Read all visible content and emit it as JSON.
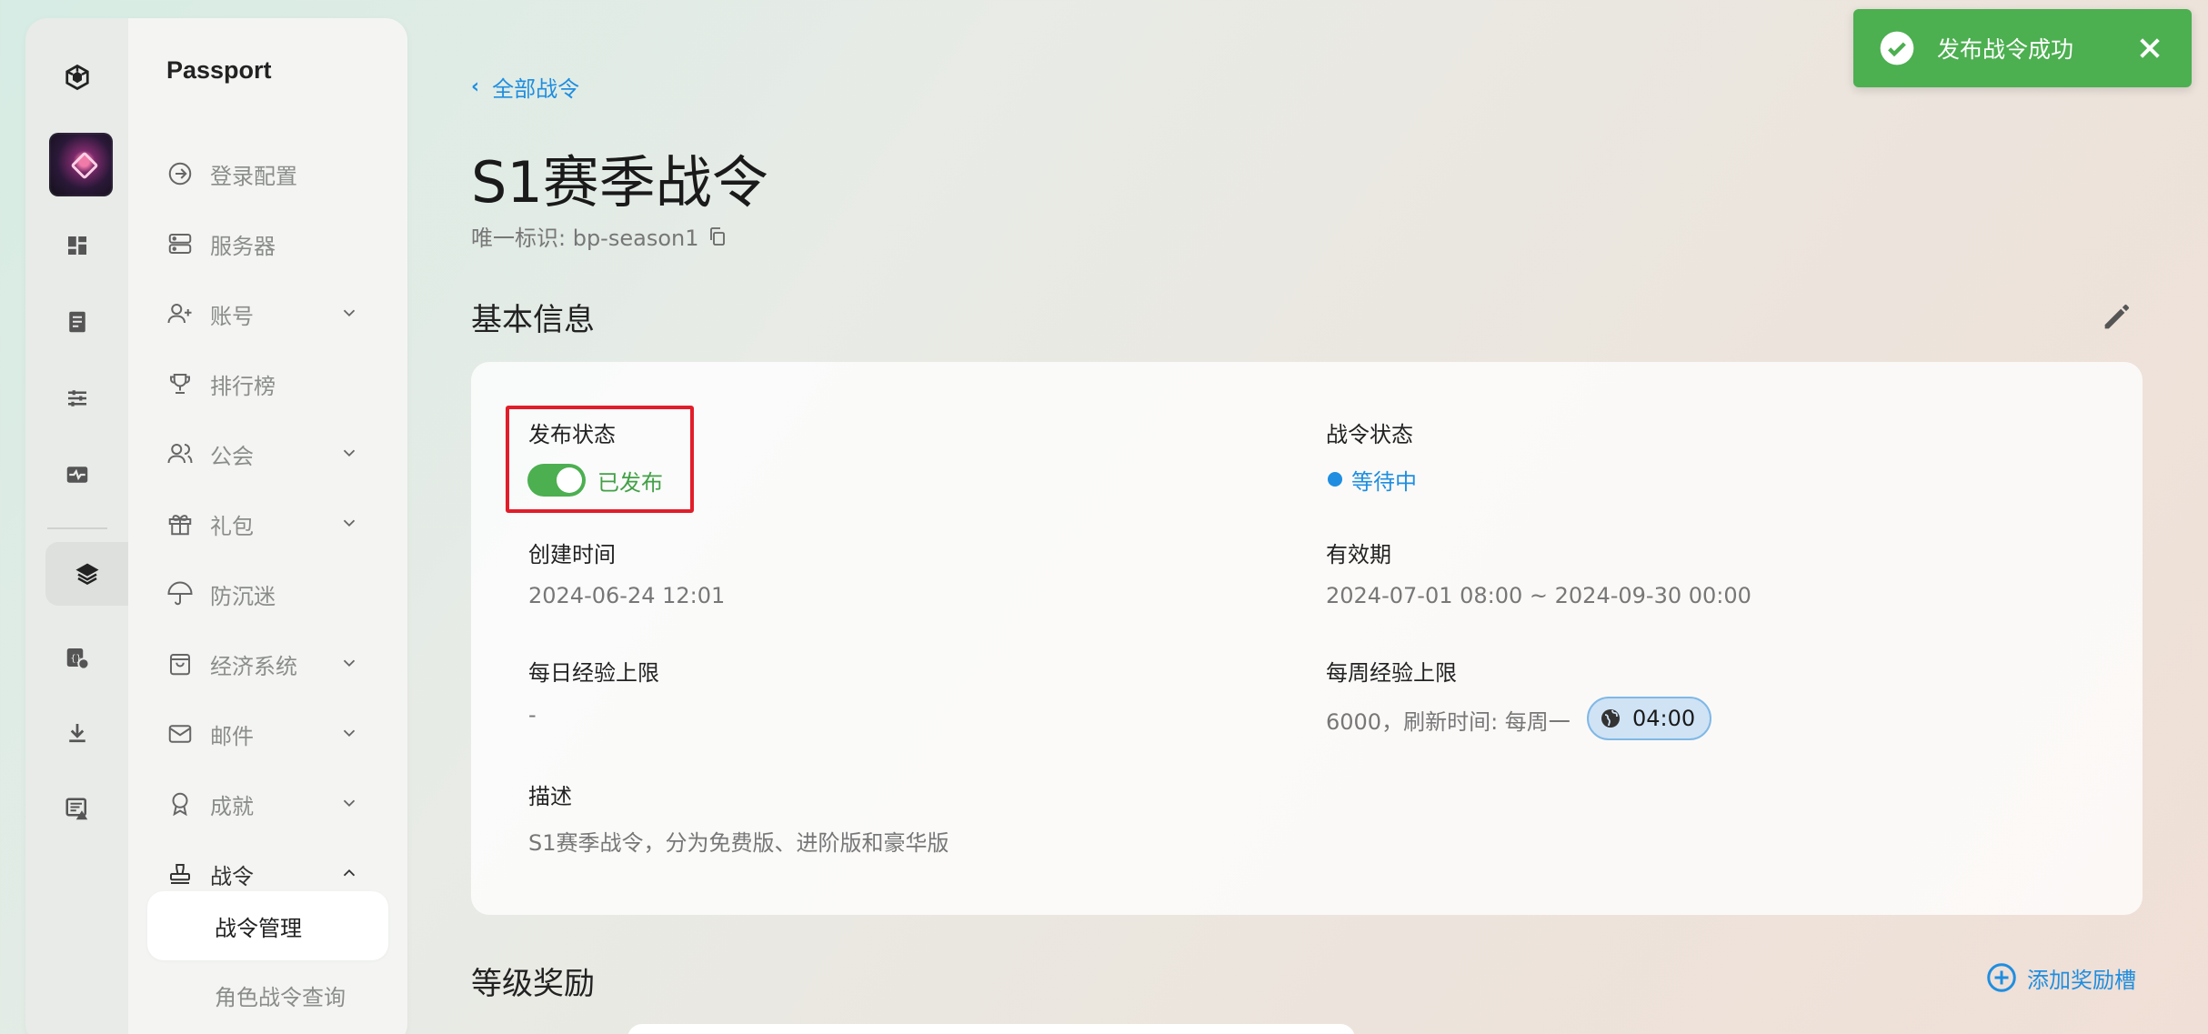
{
  "brand": "Passport",
  "menu": {
    "items": [
      {
        "label": "登录配置",
        "icon": "arrow-right-circle-icon"
      },
      {
        "label": "服务器",
        "icon": "server-icon"
      },
      {
        "label": "账号",
        "icon": "user-plus-icon"
      },
      {
        "label": "排行榜",
        "icon": "trophy-icon"
      },
      {
        "label": "公会",
        "icon": "users-icon"
      },
      {
        "label": "礼包",
        "icon": "gift-icon"
      },
      {
        "label": "防沉迷",
        "icon": "umbrella-icon"
      },
      {
        "label": "经济系统",
        "icon": "shopping-bag-icon"
      },
      {
        "label": "邮件",
        "icon": "mail-icon"
      },
      {
        "label": "成就",
        "icon": "award-icon"
      },
      {
        "label": "战令",
        "icon": "stamp-icon"
      }
    ],
    "subitems": [
      {
        "label": "战令管理"
      },
      {
        "label": "角色战令查询"
      }
    ]
  },
  "breadcrumb": {
    "back_label": "全部战令"
  },
  "page": {
    "title": "S1赛季战令",
    "uid_label": "唯一标识: bp-season1"
  },
  "basic_info": {
    "section_title": "基本信息",
    "publish_status_label": "发布状态",
    "publish_status_value": "已发布",
    "pass_status_label": "战令状态",
    "pass_status_value": "等待中",
    "created_label": "创建时间",
    "created_value": "2024-06-24 12:01",
    "validity_label": "有效期",
    "validity_value": "2024-07-01 08:00 ~ 2024-09-30 00:00",
    "daily_exp_label": "每日经验上限",
    "daily_exp_value": "-",
    "weekly_exp_label": "每周经验上限",
    "weekly_exp_value": "6000，刷新时间: 每周一",
    "weekly_refresh_time": "04:00",
    "description_label": "描述",
    "description_value": "S1赛季战令，分为免费版、进阶版和豪华版"
  },
  "rewards": {
    "section_title": "等级奖励",
    "add_label": "添加奖励槽"
  },
  "toast": {
    "message": "发布战令成功"
  },
  "colors": {
    "accent": "#1f8ee0",
    "success": "#4caf50",
    "highlight_border": "#e21d2a"
  }
}
